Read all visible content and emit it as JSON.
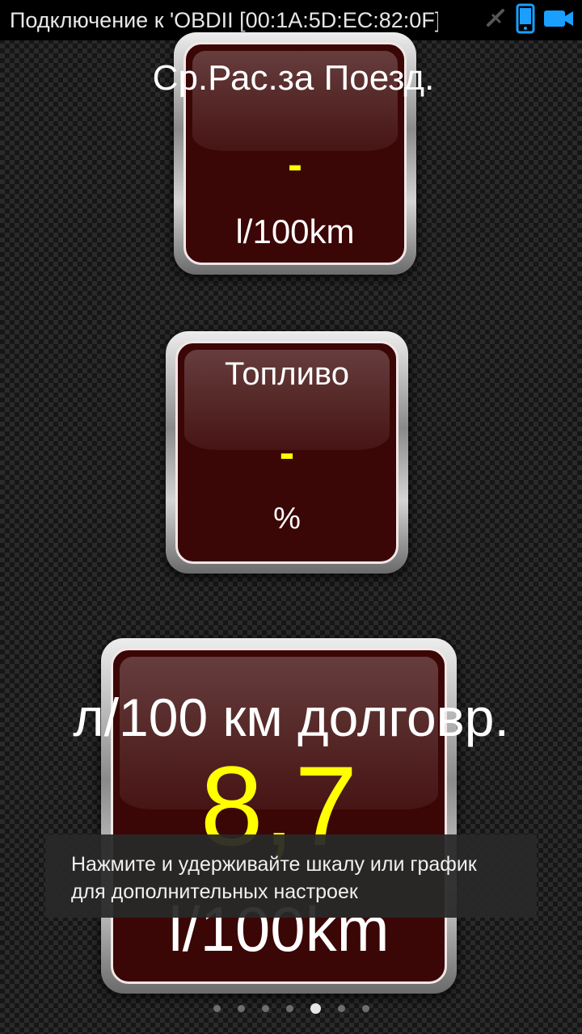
{
  "status_bar": {
    "connection_text": "Подключение к 'OBDII [00:1A:5D:EC:82:0F]'",
    "icons": [
      "connection-off-icon",
      "phone-device-icon",
      "camera-icon"
    ],
    "accent_color": "#1a9fff"
  },
  "gauges": [
    {
      "title": "Ср.Рас.за Поезд.",
      "value": "-",
      "unit": "l/100km"
    },
    {
      "title": "Топливо",
      "value": "-",
      "unit": "%"
    },
    {
      "title": "л/100 км долговр.",
      "value": "8,7",
      "unit": "l/100km"
    }
  ],
  "toast": {
    "text": "Нажмите и удерживайте шкалу или график для дополнительных настроек"
  },
  "pager": {
    "page_count": 7,
    "active_page": 5
  },
  "colors": {
    "gauge_face": "#3b0606",
    "value_color": "#ffff00"
  }
}
